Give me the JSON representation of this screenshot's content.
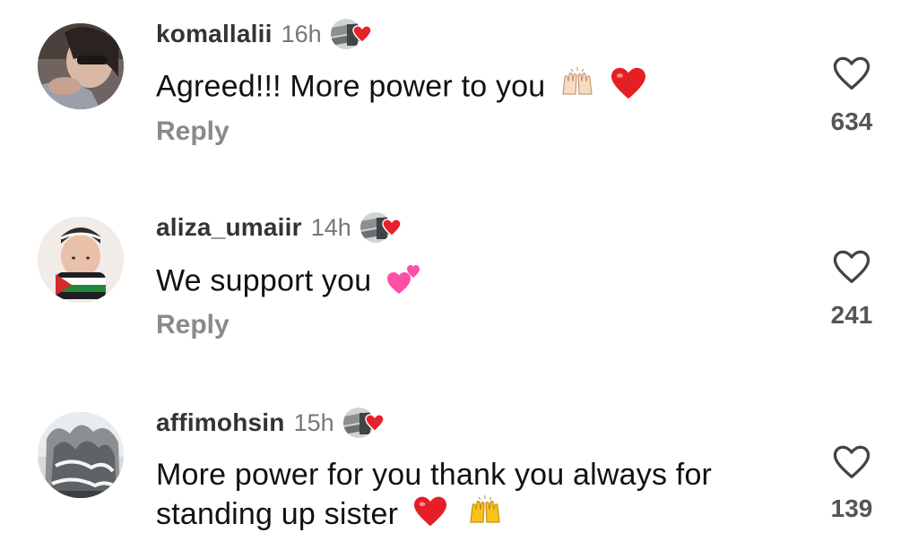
{
  "comments": [
    {
      "username": "komallalii",
      "time": "16h",
      "text": "Agreed!!! More power to you",
      "emojis": [
        "raising-hands-light",
        "red-heart"
      ],
      "reply": "Reply",
      "likes": "634"
    },
    {
      "username": "aliza_umaiir",
      "time": "14h",
      "text": "We support you",
      "emojis": [
        "two-hearts"
      ],
      "reply": "Reply",
      "likes": "241"
    },
    {
      "username": "affimohsin",
      "time": "15h",
      "text_line1": "More power for you thank you always for",
      "text_line2": "standing up sister",
      "emojis": [
        "red-heart",
        "raising-hands"
      ],
      "likes": "139"
    }
  ],
  "colors": {
    "username": "#333333",
    "meta": "#777777",
    "reply": "#8a8a8a",
    "heart": "#e8202a",
    "pink_heart": "#ff4fa6"
  }
}
